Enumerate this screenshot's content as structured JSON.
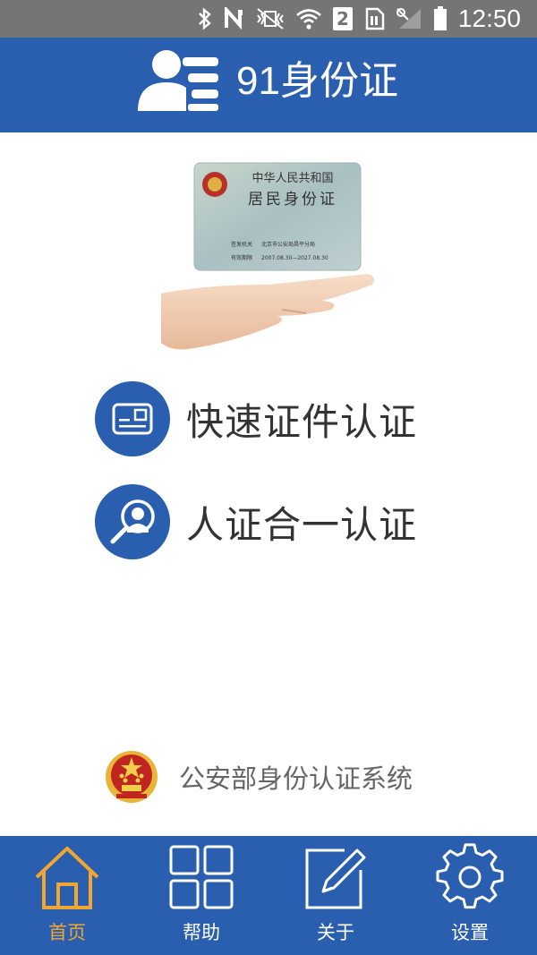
{
  "status_bar": {
    "time": "12:50",
    "sim_slot": "2",
    "icons": [
      "bluetooth-icon",
      "nfc-icon",
      "vibrate-icon",
      "wifi-icon",
      "sim-2-icon",
      "data-icon",
      "signal-icon",
      "battery-icon"
    ]
  },
  "header": {
    "title": "91身份证",
    "logo_icon": "id-user-list-icon"
  },
  "hero": {
    "card_country": "中华人民共和国",
    "card_title": "居民身份证",
    "card_issuer_label": "签发机关",
    "card_issuer": "北京市公安局昌平分局",
    "card_validity_label": "有效期限",
    "card_validity": "2007.08.30—2027.08.30"
  },
  "options": [
    {
      "label": "快速证件认证",
      "icon": "id-card-icon"
    },
    {
      "label": "人证合一认证",
      "icon": "face-search-icon"
    }
  ],
  "brand": {
    "text": "公安部身份认证系统",
    "emblem_icon": "national-emblem-icon"
  },
  "bottom_nav": [
    {
      "label": "首页",
      "icon": "home-icon",
      "active": true
    },
    {
      "label": "帮助",
      "icon": "grid-icon",
      "active": false
    },
    {
      "label": "关于",
      "icon": "edit-icon",
      "active": false
    },
    {
      "label": "设置",
      "icon": "gear-icon",
      "active": false
    }
  ],
  "colors": {
    "primary": "#2a5eae",
    "active_nav": "#f0a630",
    "status_bar": "#757575",
    "text_dark": "#333333",
    "text_muted": "#666666"
  }
}
